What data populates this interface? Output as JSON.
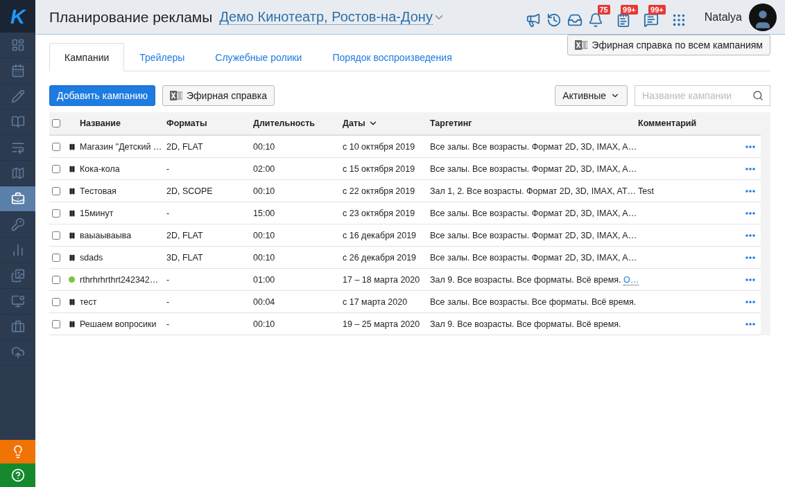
{
  "logo": "K",
  "sidebar": {
    "items": [
      {
        "selected": false
      },
      {
        "selected": false
      },
      {
        "selected": false
      },
      {
        "selected": false
      },
      {
        "selected": false
      },
      {
        "selected": false
      },
      {
        "selected": true
      },
      {
        "selected": false
      },
      {
        "selected": false
      },
      {
        "selected": false
      },
      {
        "selected": false
      },
      {
        "selected": false
      },
      {
        "selected": false
      }
    ],
    "bottom": [
      {
        "color": "#f07306"
      },
      {
        "color": "#158a2c"
      }
    ]
  },
  "header": {
    "title": "Планирование рекламы",
    "cinema": "Демо Кинотеатр, Ростов-на-Дону",
    "badges": [
      "75",
      "99+",
      "99+"
    ],
    "user": "Natalya"
  },
  "tabs": [
    {
      "label": "Кампании",
      "selected": true
    },
    {
      "label": "Трейлеры",
      "selected": false
    },
    {
      "label": "Служебные ролики",
      "selected": false
    },
    {
      "label": "Порядок воспроизведения",
      "selected": false
    }
  ],
  "report_all_button": "Эфирная справка по всем кампаниям",
  "toolbar": {
    "add_button": "Добавить кампанию",
    "report_button": "Эфирная справка",
    "filter": "Активные",
    "search_placeholder": "Название кампании"
  },
  "table": {
    "all_checked": false,
    "columns": [
      "Название",
      "Форматы",
      "Длительность",
      "Даты",
      "Таргетинг",
      "Комментарий"
    ],
    "rows": [
      {
        "checked": false,
        "kind": "paused",
        "name": "Магазин \"Детский …",
        "formats": "2D, FLAT",
        "duration": "00:10",
        "dates": "с 10 октября 2019",
        "targeting": "Все залы. Все возрасты. Формат 2D, 3D, IMAX, A…"
      },
      {
        "checked": false,
        "kind": "paused",
        "name": "Кока-кола",
        "formats": "-",
        "duration": "02:00",
        "dates": "с 15 октября 2019",
        "targeting": "Все залы. Все возрасты. Формат 2D, 3D, IMAX, A…"
      },
      {
        "checked": false,
        "kind": "paused",
        "name": "Тестовая",
        "formats": "2D, SCOPE",
        "duration": "00:10",
        "dates": "с 22 октября 2019",
        "targeting": "Зал 1, 2. Все возрасты. Формат 2D, 3D, IMAX, AT…",
        "comment": "Test"
      },
      {
        "checked": false,
        "kind": "paused",
        "name": "15минут",
        "formats": "-",
        "duration": "15:00",
        "dates": "с 23 октября 2019",
        "targeting": "Все залы. Все возрасты. Формат 2D, 3D, IMAX, A…"
      },
      {
        "checked": false,
        "kind": "paused",
        "name": "ваыаываыва",
        "formats": "2D, FLAT",
        "duration": "00:10",
        "dates": "с 16 декабря 2019",
        "targeting": "Все залы. Все возрасты. Формат 2D, 3D, IMAX, A…"
      },
      {
        "checked": false,
        "kind": "paused",
        "name": "sdads",
        "formats": "3D, FLAT",
        "duration": "00:10",
        "dates": "с 26 декабря 2019",
        "targeting": "Все залы. Все возрасты. Формат 2D, 3D, IMAX, A…"
      },
      {
        "checked": false,
        "kind": "active",
        "name": "rthrhrhrthrt242342…",
        "formats": "-",
        "duration": "01:00",
        "dates": "17 – 18 марта 2020",
        "targeting": "Зал 9. Все возрасты. Все форматы. Всё время.",
        "targeting_more": "О…"
      },
      {
        "checked": false,
        "kind": "paused",
        "name": "тест",
        "formats": "-",
        "duration": "00:04",
        "dates": "с 17 марта 2020",
        "targeting": "Все залы. Все возрасты. Все форматы. Всё время."
      },
      {
        "checked": false,
        "kind": "paused",
        "name": "Решаем вопросики",
        "formats": "-",
        "duration": "00:10",
        "dates": "19 – 25 марта 2020",
        "targeting": "Зал 9. Все возрасты. Все форматы. Всё время."
      }
    ]
  }
}
